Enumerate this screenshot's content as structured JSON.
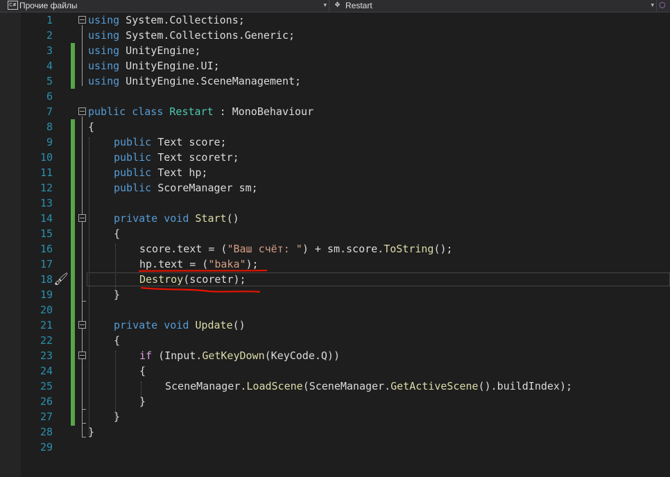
{
  "navbar": {
    "file_label": "Прочие файлы",
    "file_icon": "C#",
    "class_label": "Restart"
  },
  "colors": {
    "background": "#1e1e1e",
    "keyword": "#569cd6",
    "type": "#4ec9b0",
    "string": "#d69d85",
    "method": "#dcdcaa",
    "line_number": "#2b91af",
    "change_bar": "#57a64a",
    "annotation": "#e51400"
  },
  "editor": {
    "current_line": 18,
    "lines": [
      {
        "n": "1",
        "indent": 0,
        "tokens": [
          [
            "kw",
            "using"
          ],
          [
            "pl",
            " System.Collections;"
          ]
        ]
      },
      {
        "n": "2",
        "indent": 0,
        "tokens": [
          [
            "kw",
            "using"
          ],
          [
            "pl",
            " System.Collections.Generic;"
          ]
        ]
      },
      {
        "n": "3",
        "indent": 0,
        "tokens": [
          [
            "kw",
            "using"
          ],
          [
            "pl",
            " UnityEngine;"
          ]
        ]
      },
      {
        "n": "4",
        "indent": 0,
        "tokens": [
          [
            "kw",
            "using"
          ],
          [
            "pl",
            " UnityEngine.UI;"
          ]
        ]
      },
      {
        "n": "5",
        "indent": 0,
        "tokens": [
          [
            "kw",
            "using"
          ],
          [
            "pl",
            " UnityEngine.SceneManagement;"
          ]
        ]
      },
      {
        "n": "6",
        "indent": 0,
        "tokens": []
      },
      {
        "n": "7",
        "indent": 0,
        "tokens": [
          [
            "kw",
            "public"
          ],
          [
            "pl",
            " "
          ],
          [
            "kw",
            "class"
          ],
          [
            "pl",
            " "
          ],
          [
            "ty",
            "Restart"
          ],
          [
            "pl",
            " : MonoBehaviour"
          ]
        ]
      },
      {
        "n": "8",
        "indent": 0,
        "tokens": [
          [
            "pl",
            "{"
          ]
        ]
      },
      {
        "n": "9",
        "indent": 1,
        "tokens": [
          [
            "kw",
            "public"
          ],
          [
            "pl",
            " Text score;"
          ]
        ]
      },
      {
        "n": "10",
        "indent": 1,
        "tokens": [
          [
            "kw",
            "public"
          ],
          [
            "pl",
            " Text scoretr;"
          ]
        ]
      },
      {
        "n": "11",
        "indent": 1,
        "tokens": [
          [
            "kw",
            "public"
          ],
          [
            "pl",
            " Text hp;"
          ]
        ]
      },
      {
        "n": "12",
        "indent": 1,
        "tokens": [
          [
            "kw",
            "public"
          ],
          [
            "pl",
            " ScoreManager sm;"
          ]
        ]
      },
      {
        "n": "13",
        "indent": 0,
        "tokens": []
      },
      {
        "n": "14",
        "indent": 1,
        "tokens": [
          [
            "kw",
            "private"
          ],
          [
            "pl",
            " "
          ],
          [
            "kw",
            "void"
          ],
          [
            "pl",
            " "
          ],
          [
            "fn",
            "Start"
          ],
          [
            "pl",
            "()"
          ]
        ]
      },
      {
        "n": "15",
        "indent": 1,
        "tokens": [
          [
            "pl",
            "{"
          ]
        ]
      },
      {
        "n": "16",
        "indent": 2,
        "tokens": [
          [
            "pl",
            "score.text = ("
          ],
          [
            "st",
            "\"Ваш счёт: \""
          ],
          [
            "pl",
            ") + sm.score."
          ],
          [
            "fn",
            "ToString"
          ],
          [
            "pl",
            "();"
          ]
        ]
      },
      {
        "n": "17",
        "indent": 2,
        "tokens": [
          [
            "pl",
            "hp.text = ("
          ],
          [
            "st",
            "\"baka\""
          ],
          [
            "pl",
            ");"
          ]
        ]
      },
      {
        "n": "18",
        "indent": 2,
        "tokens": [
          [
            "fn",
            "Destroy"
          ],
          [
            "pl",
            "(scoretr);"
          ]
        ]
      },
      {
        "n": "19",
        "indent": 1,
        "tokens": [
          [
            "pl",
            "}"
          ]
        ]
      },
      {
        "n": "20",
        "indent": 0,
        "tokens": []
      },
      {
        "n": "21",
        "indent": 1,
        "tokens": [
          [
            "kw",
            "private"
          ],
          [
            "pl",
            " "
          ],
          [
            "kw",
            "void"
          ],
          [
            "pl",
            " "
          ],
          [
            "fn",
            "Update"
          ],
          [
            "pl",
            "()"
          ]
        ]
      },
      {
        "n": "22",
        "indent": 1,
        "tokens": [
          [
            "pl",
            "{"
          ]
        ]
      },
      {
        "n": "23",
        "indent": 2,
        "tokens": [
          [
            "ctl",
            "if"
          ],
          [
            "pl",
            " (Input."
          ],
          [
            "fn",
            "GetKeyDown"
          ],
          [
            "pl",
            "(KeyCode.Q))"
          ]
        ]
      },
      {
        "n": "24",
        "indent": 2,
        "tokens": [
          [
            "pl",
            "{"
          ]
        ]
      },
      {
        "n": "25",
        "indent": 3,
        "tokens": [
          [
            "pl",
            "SceneManager."
          ],
          [
            "fn",
            "LoadScene"
          ],
          [
            "pl",
            "(SceneManager."
          ],
          [
            "fn",
            "GetActiveScene"
          ],
          [
            "pl",
            "().buildIndex);"
          ]
        ]
      },
      {
        "n": "26",
        "indent": 2,
        "tokens": [
          [
            "pl",
            "}"
          ]
        ]
      },
      {
        "n": "27",
        "indent": 1,
        "tokens": [
          [
            "pl",
            "}"
          ]
        ]
      },
      {
        "n": "28",
        "indent": 0,
        "tokens": [
          [
            "pl",
            "}"
          ]
        ]
      },
      {
        "n": "29",
        "indent": 0,
        "tokens": []
      }
    ]
  }
}
